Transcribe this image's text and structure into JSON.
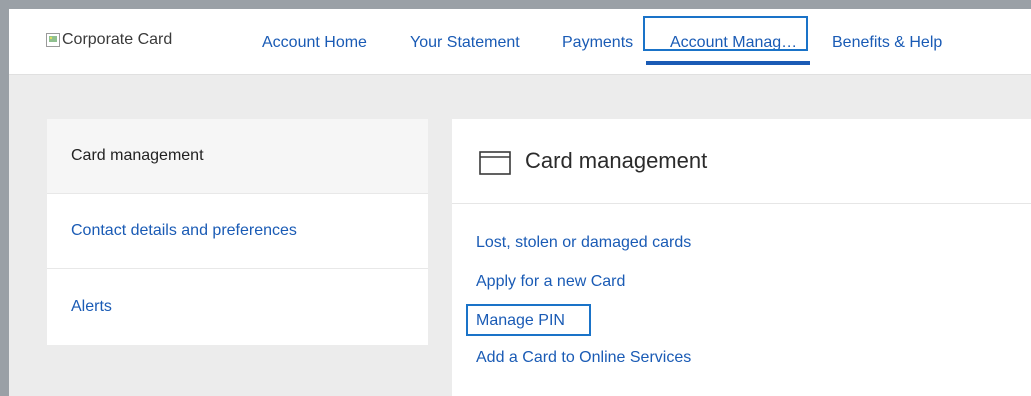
{
  "header": {
    "logo_alt": "Corporate Card",
    "nav": [
      {
        "label": "Account Home"
      },
      {
        "label": "Your Statement"
      },
      {
        "label": "Payments"
      },
      {
        "label": "Account Manag…"
      },
      {
        "label": "Benefits & Help"
      }
    ],
    "active_nav": "Account Manag…"
  },
  "sidebar": {
    "items": [
      {
        "label": "Card management",
        "selected": true
      },
      {
        "label": "Contact details and preferences",
        "selected": false
      },
      {
        "label": "Alerts",
        "selected": false
      }
    ]
  },
  "main": {
    "title": "Card management",
    "title_icon": "credit-card-icon",
    "links": [
      {
        "label": "Lost, stolen or damaged cards"
      },
      {
        "label": "Apply for a new Card"
      },
      {
        "label": "Manage PIN",
        "highlighted": true
      },
      {
        "label": "Add a Card to Online Services"
      }
    ]
  },
  "colors": {
    "link": "#1a5bb5",
    "highlight_border": "#1a73c8",
    "background": "#ececec"
  }
}
